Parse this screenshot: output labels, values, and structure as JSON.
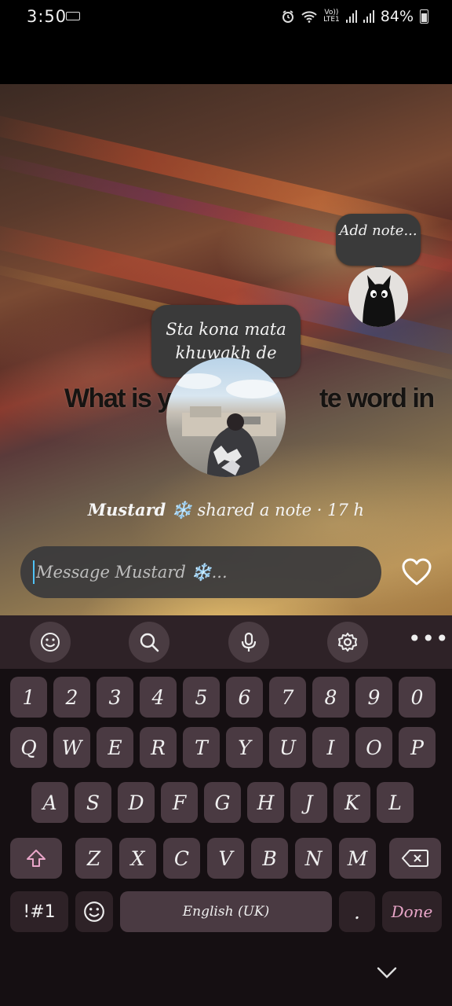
{
  "status_bar": {
    "time": "3:50",
    "network_top": "Vo))",
    "network_bottom": "LTE1",
    "battery": "84%"
  },
  "background_overlay_text": "What is yo",
  "background_overlay_text_end": "te word in",
  "notes": {
    "self_note": "Add note...",
    "friend_note_line1": "Sta kona mata",
    "friend_note_line2": "khuwakh de"
  },
  "shared": {
    "name": "Mustard ❄️",
    "text": "shared a note · 17 h"
  },
  "message": {
    "placeholder": "Message Mustard ❄️..."
  },
  "keyboard": {
    "toolbar": [
      "emoji-icon",
      "search-icon",
      "mic-icon",
      "settings-icon",
      "more-icon"
    ],
    "row_numbers": [
      "1",
      "2",
      "3",
      "4",
      "5",
      "6",
      "7",
      "8",
      "9",
      "0"
    ],
    "row_q": [
      "Q",
      "W",
      "E",
      "R",
      "T",
      "Y",
      "U",
      "I",
      "O",
      "P"
    ],
    "row_a": [
      "A",
      "S",
      "D",
      "F",
      "G",
      "H",
      "J",
      "K",
      "L"
    ],
    "row_z": [
      "Z",
      "X",
      "C",
      "V",
      "B",
      "N",
      "M"
    ],
    "symbols_label": "!#1",
    "space_label": "English (UK)",
    "period_label": ".",
    "done_label": "Done"
  },
  "colors": {
    "accent_caret": "#4fc3f7",
    "key_bg": "#4a3a42",
    "keyboard_bg": "#150f12",
    "done_text": "#e9a6c9"
  }
}
